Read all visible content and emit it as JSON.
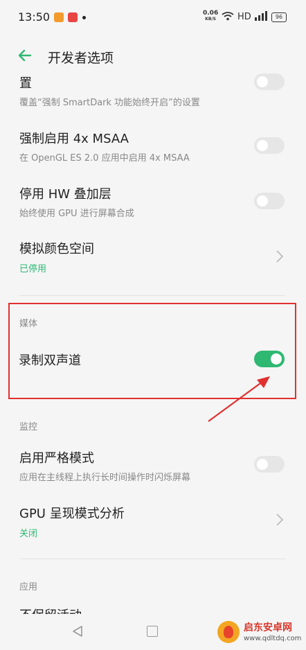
{
  "status_bar": {
    "time": "13:50",
    "net_speed_value": "0.06",
    "net_speed_unit": "KB/S",
    "hd": "HD",
    "battery": "96"
  },
  "header": {
    "title": "开发者选项"
  },
  "rows": {
    "smartdark": {
      "title": "置",
      "subtitle": "覆盖“强制 SmartDark 功能始终开启”的设置",
      "enabled": false
    },
    "msaa": {
      "title": "强制启用 4x MSAA",
      "subtitle": "在 OpenGL ES 2.0 应用中启用 4x MSAA",
      "enabled": false
    },
    "hw_overlay": {
      "title": "停用 HW 叠加层",
      "subtitle": "始终使用 GPU 进行屏幕合成",
      "enabled": false
    },
    "color_space": {
      "title": "模拟颜色空间",
      "status": "已停用"
    },
    "stereo": {
      "title": "录制双声道",
      "enabled": true
    },
    "strict_mode": {
      "title": "启用严格模式",
      "subtitle": "应用在主线程上执行长时间操作时闪烁屏幕",
      "enabled": false
    },
    "gpu_profile": {
      "title": "GPU 呈现模式分析",
      "status": "关闭"
    },
    "partial_app": {
      "title": "不保留活动"
    }
  },
  "sections": {
    "media": "媒体",
    "monitoring": "监控",
    "apps": "应用"
  },
  "watermark": {
    "name": "启东安卓网",
    "url": "www.qdltdq.com"
  },
  "colors": {
    "accent": "#2eb872",
    "highlight": "#e0302f",
    "background": "#f5f5f5"
  }
}
